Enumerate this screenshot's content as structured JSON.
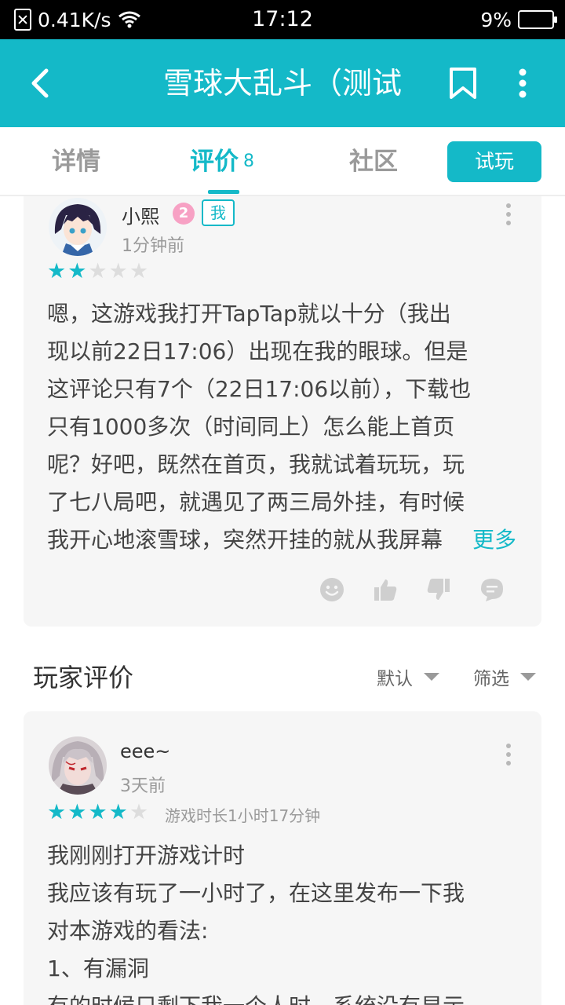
{
  "status_bar": {
    "net_speed": "0.41K/s",
    "clock": "17:12",
    "battery": "9%",
    "battery_level": 0.09
  },
  "app_bar": {
    "title": "雪球大乱斗（测试"
  },
  "tabs": [
    {
      "label": "详情"
    },
    {
      "label": "评价",
      "count": "8"
    },
    {
      "label": "社区"
    }
  ],
  "try_button": "试玩",
  "my_review": {
    "username": "小熙",
    "level": "2",
    "me_badge": "我",
    "time": "1分钟前",
    "rating": 2,
    "lines": [
      "嗯，这游戏我打开TapTap就以十分（我出",
      "现以前22日17:06）出现在我的眼球。但是",
      "这评论只有7个（22日17:06以前），下载也",
      "只有1000多次（时间同上）怎么能上首页",
      "呢？好吧，既然在首页，我就试着玩玩，玩",
      "了七八局吧，就遇见了两三局外挂，有时候",
      "我开心地滚雪球，突然开挂的就从我屏幕"
    ],
    "more_label": "更多",
    "actions": [
      "smile-icon",
      "thumb-up-icon",
      "thumb-down-icon",
      "comment-icon"
    ]
  },
  "section": {
    "title": "玩家评价",
    "sort_label": "默认",
    "filter_label": "筛选"
  },
  "review2": {
    "username": "eee~",
    "time": "3天前",
    "rating": 4,
    "playtime": "游戏时长1小时17分钟",
    "lines": [
      "我刚刚打开游戏计时",
      "我应该有玩了一小时了，在这里发布一下我",
      "对本游戏的看法:",
      "1、有漏洞",
      "有的时候只剩下我一个人时，系统没有显示"
    ]
  },
  "colors": {
    "accent": "#14b9c8",
    "card_bg": "#f6f6f6",
    "star_off": "#dddddd"
  }
}
